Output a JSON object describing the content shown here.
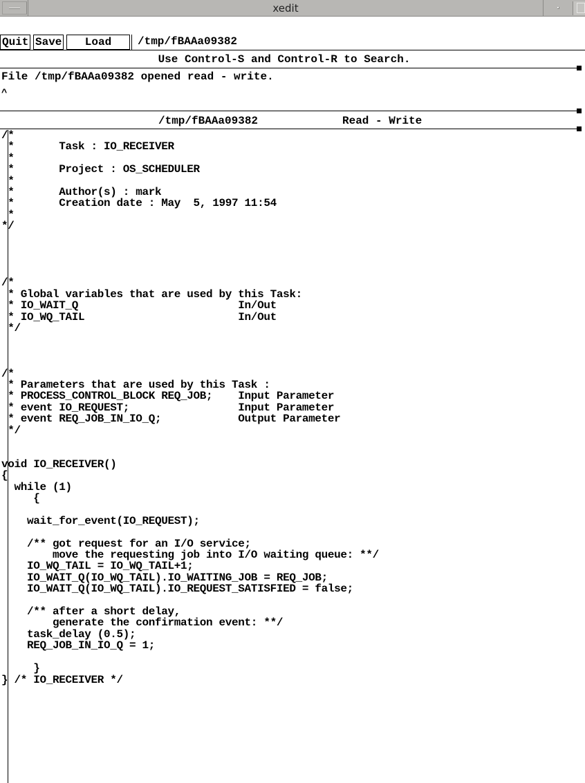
{
  "window": {
    "title": "xedit"
  },
  "toolbar": {
    "quit_label": "Quit",
    "save_label": "Save",
    "load_label": "Load",
    "filename": "/tmp/fBAAa09382"
  },
  "search_hint": "Use Control-S and Control-R to Search.",
  "message": {
    "line1": "File /tmp/fBAAa09382 opened read - write.",
    "line2": "^"
  },
  "status": {
    "path": "/tmp/fBAAa09382",
    "mode": "Read - Write"
  },
  "editor": {
    "text": "/*\n *       Task : IO_RECEIVER\n *\n *       Project : OS_SCHEDULER\n *\n *       Author(s) : mark\n *       Creation date : May  5, 1997 11:54\n *\n*/\n\n\n\n\n/*\n * Global variables that are used by this Task:\n * IO_WAIT_Q                         In/Out\n * IO_WQ_TAIL                        In/Out\n */\n\n\n\n/*\n * Parameters that are used by this Task :\n * PROCESS_CONTROL_BLOCK REQ_JOB;    Input Parameter\n * event IO_REQUEST;                 Input Parameter\n * event REQ_JOB_IN_IO_Q;            Output Parameter\n */\n\n\nvoid IO_RECEIVER()\n{\n  while (1)\n     {\n\n    wait_for_event(IO_REQUEST);\n\n    /** got request for an I/O service;\n        move the requesting job into I/O waiting queue: **/\n    IO_WQ_TAIL = IO_WQ_TAIL+1;\n    IO_WAIT_Q(IO_WQ_TAIL).IO_WAITING_JOB = REQ_JOB;\n    IO_WAIT_Q(IO_WQ_TAIL).IO_REQUEST_SATISFIED = false;\n\n    /** after a short delay,\n        generate the confirmation event: **/\n    task_delay (0.5);\n    REQ_JOB_IN_IO_Q = 1;\n\n     }\n} /* IO_RECEIVER */"
  }
}
